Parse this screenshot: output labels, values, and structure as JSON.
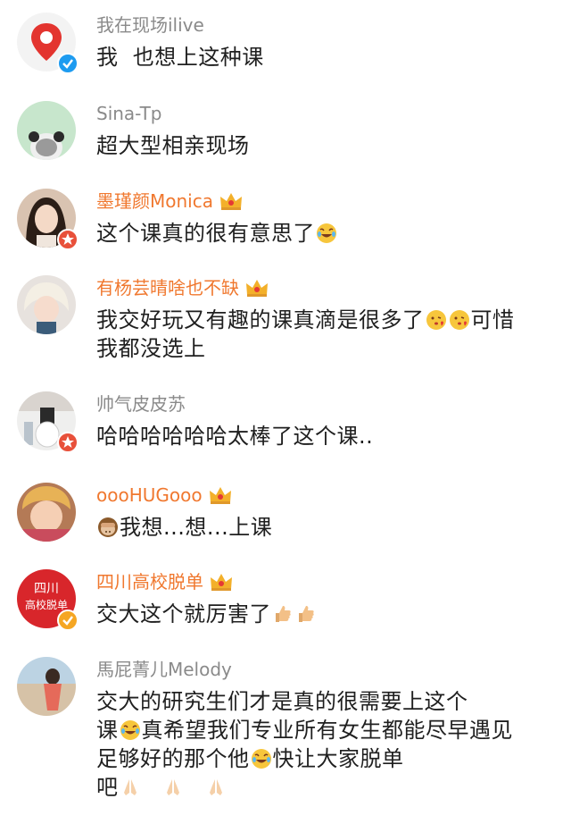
{
  "colors": {
    "name_plain": "#8a8a8a",
    "name_vip": "#f0782f",
    "text": "#1f1f1f",
    "badge_blue": "#1d9bf0",
    "badge_orange": "#f5a623",
    "badge_red": "#e8503a",
    "crown_gold": "#f3b02a"
  },
  "comments": [
    {
      "name": "我在现场ilive",
      "line1": "我  也想上这种课",
      "avatar_icon": "map-pin-logo-icon",
      "badge": "blue-verified-icon"
    },
    {
      "name": "Sina-Tp",
      "line1": "超大型相亲现场",
      "avatar_icon": "panda-avatar-icon"
    },
    {
      "name": "墨瑾颜Monica",
      "line1": "这个课真的很有意思了",
      "emoji_after": "laugh-cry-emoji",
      "avatar_icon": "girl-photo-avatar",
      "badge": "red-star-badge-icon",
      "vip": true
    },
    {
      "name": "有杨芸晴啥也不缺",
      "line1": "我交好玩又有趣的课真滴是很多了",
      "line1_tail": "可惜",
      "line2": "我都没选上",
      "emoji_after": "heart-kiss-emoji",
      "avatar_icon": "blonde-photo-avatar",
      "vip": true
    },
    {
      "name": "帅气皮皮苏",
      "line1": "哈哈哈哈哈哈太棒了这个课..",
      "avatar_icon": "room-photo-avatar",
      "badge": "red-star-badge-icon"
    },
    {
      "name": "oooHUGooo",
      "line1_before": "我想...想...上课",
      "emoji_before": "monkey-see-no-evil-emoji",
      "avatar_icon": "child-photo-avatar",
      "vip": true
    },
    {
      "name": "四川高校脱单",
      "line1": "交大这个就厉害了",
      "emoji_after": "thumbs-up-emoji",
      "avatar_icon": "sichuan-logo-avatar",
      "avatar_text_1": "四川",
      "avatar_text_2": "高校脱单",
      "badge": "orange-verified-icon",
      "vip": true
    },
    {
      "name": "馬屁菁儿Melody",
      "line1": "交大的研究生们才是真的很需要上这个",
      "line2a": "课",
      "line2b": "真希望我们专业所有女生都能尽早遇见",
      "line3a": "足够好的那个他",
      "line3b": "快让大家脱单",
      "line4": "吧",
      "emoji_cry": "laugh-cry-emoji",
      "emoji_pray": "pray-hands-emoji",
      "avatar_icon": "beach-photo-avatar"
    }
  ]
}
